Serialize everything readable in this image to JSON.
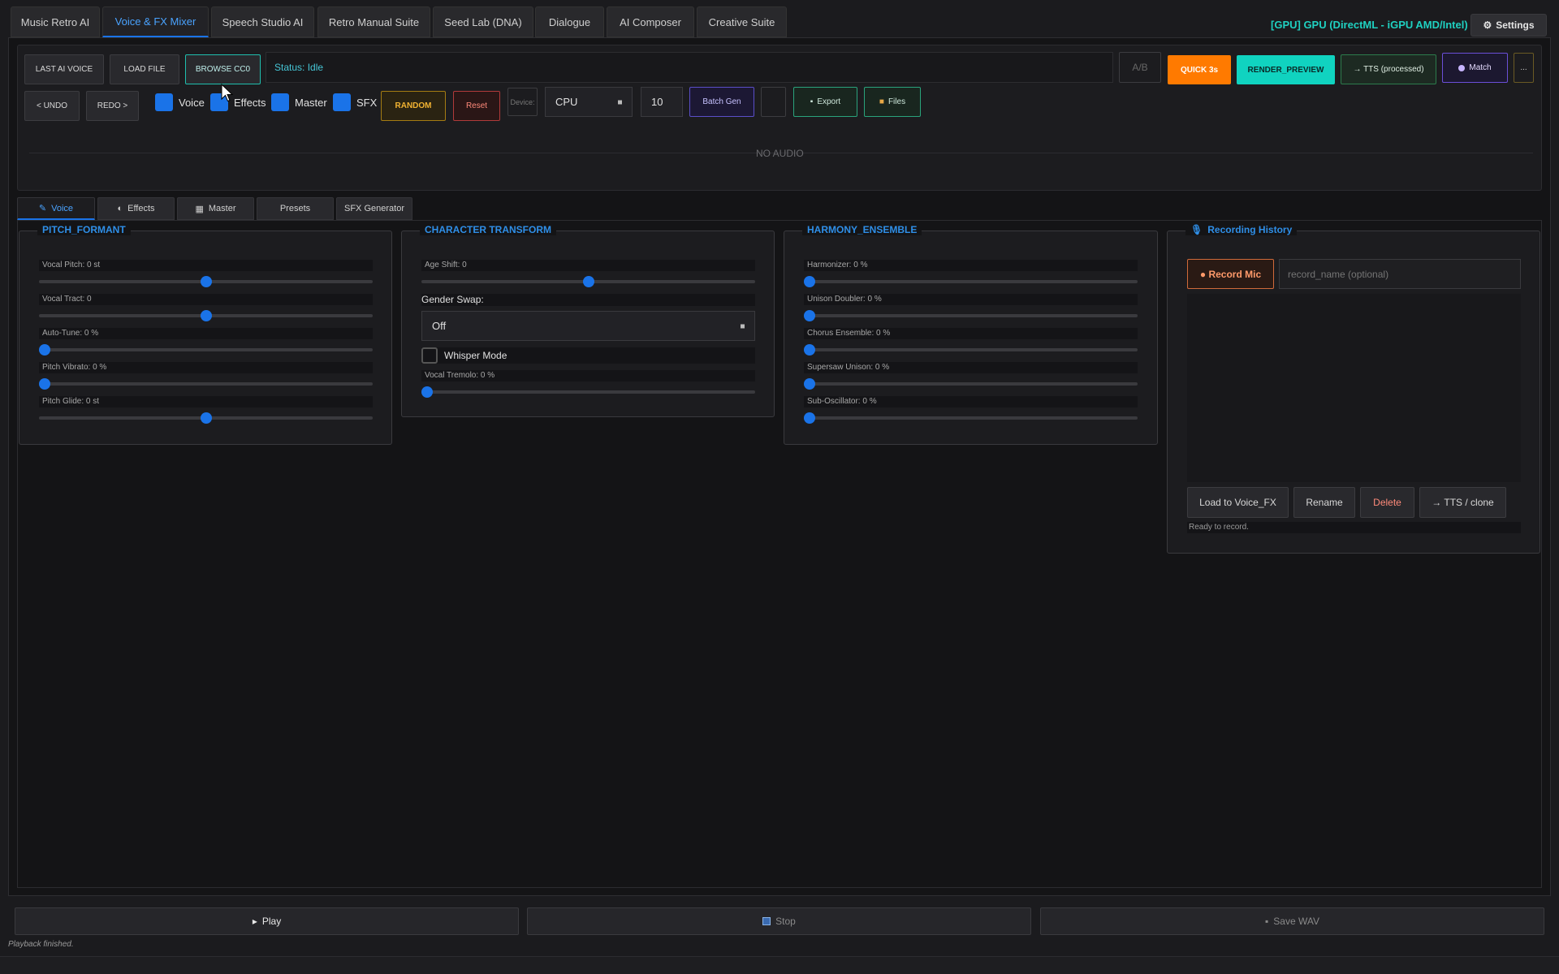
{
  "top_tabs": [
    {
      "label": "Music Retro AI"
    },
    {
      "label": "Voice & FX Mixer"
    },
    {
      "label": "Speech Studio AI"
    },
    {
      "label": "Retro Manual Suite"
    },
    {
      "label": "Seed Lab (DNA)"
    },
    {
      "label": "Dialogue"
    },
    {
      "label": "AI Composer"
    },
    {
      "label": "Creative Suite"
    }
  ],
  "gpu_label": "[GPU] GPU (DirectML - iGPU AMD/Intel)",
  "settings_label": "Settings",
  "toolbar": {
    "last_ai_voice": "LAST AI VOICE",
    "load_file": "LOAD FILE",
    "browse_cc0": "BROWSE CC0",
    "status": "Status: Idle",
    "ab": "A/B",
    "quick": "QUICK 3s",
    "render_preview": "RENDER_PREVIEW",
    "tts_processed": "→ TTS (processed)",
    "match": "Match",
    "more": "...",
    "undo": "< UNDO",
    "redo": "REDO >",
    "chk_voice": "Voice",
    "chk_effects": "Effects",
    "chk_master": "Master",
    "chk_sfx": "SFX",
    "random": "RANDOM",
    "reset": "Reset",
    "device_label": "Device:",
    "device_value": "CPU",
    "batch_count": "10",
    "batch_gen": "Batch Gen",
    "export": "Export",
    "files": "Files",
    "no_audio": "NO AUDIO"
  },
  "sub_tabs": [
    {
      "label": "Voice"
    },
    {
      "label": "Effects"
    },
    {
      "label": "Master"
    },
    {
      "label": "Presets"
    },
    {
      "label": "SFX Generator"
    }
  ],
  "pitch_formant": {
    "title": "PITCH_FORMANT",
    "sliders": [
      {
        "label": "Vocal Pitch: 0 st",
        "fraction": 0.5
      },
      {
        "label": "Vocal Tract: 0",
        "fraction": 0.5
      },
      {
        "label": "Auto-Tune: 0 %",
        "fraction": 0.0
      },
      {
        "label": "Pitch Vibrato: 0 %",
        "fraction": 0.0
      },
      {
        "label": "Pitch Glide: 0 st",
        "fraction": 0.5
      }
    ]
  },
  "character_transform": {
    "title": "CHARACTER TRANSFORM",
    "age_shift": {
      "label": "Age Shift: 0",
      "fraction": 0.5
    },
    "gender_swap_label": "Gender Swap:",
    "gender_swap_value": "Off",
    "whisper_mode": "Whisper Mode",
    "vocal_tremolo": {
      "label": "Vocal Tremolo: 0 %",
      "fraction": 0.0
    }
  },
  "harmony_ensemble": {
    "title": "HARMONY_ENSEMBLE",
    "sliders": [
      {
        "label": "Harmonizer: 0 %",
        "fraction": 0.0
      },
      {
        "label": "Unison Doubler: 0 %",
        "fraction": 0.0
      },
      {
        "label": "Chorus Ensemble: 0 %",
        "fraction": 0.0
      },
      {
        "label": "Supersaw Unison: 0 %",
        "fraction": 0.0
      },
      {
        "label": "Sub-Oscillator: 0 %",
        "fraction": 0.0
      }
    ]
  },
  "recording_history": {
    "title": "Recording History",
    "record_mic": "● Record Mic",
    "name_placeholder": "record_name (optional)",
    "load_to_voice_fx": "Load to Voice_FX",
    "rename": "Rename",
    "delete": "Delete",
    "tts_clone": "→ TTS / clone",
    "status": "Ready to record."
  },
  "bottom": {
    "play": "Play",
    "stop": "Stop",
    "save_wav": "Save WAV",
    "status": "Playback finished."
  },
  "colors": {
    "accent": "#1a73e8",
    "quick": "#ff7a00",
    "render_preview": "#10d3c0",
    "teal_text": "#1fd1c1"
  }
}
